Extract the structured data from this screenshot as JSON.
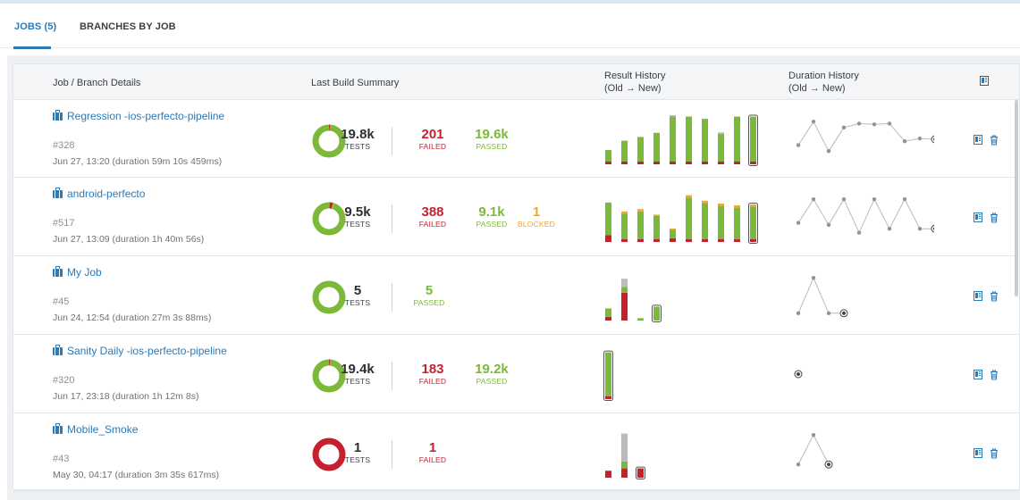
{
  "tabs": [
    {
      "label": "JOBS (5)",
      "active": true
    },
    {
      "label": "BRANCHES BY JOB",
      "active": false
    }
  ],
  "columns": {
    "job": "Job / Branch Details",
    "summary": "Last Build Summary",
    "result_history": "Result History",
    "result_history_sub": "(Old → New)",
    "duration_history": "Duration History",
    "duration_history_sub": "(Old → New)"
  },
  "colors": {
    "accent": "#2a7ab8",
    "passed": "#7cb83a",
    "failed": "#c8202f",
    "blocked": "#f5a623",
    "skipped": "#bbbbbb"
  },
  "jobs": [
    {
      "name": "Regression -ios-perfecto-pipeline",
      "build": "#328",
      "date": "Jun 27, 13:20 (duration 59m 10s 459ms)",
      "tests": "19.8k",
      "tests_label": "TESTS",
      "failed": "201",
      "failed_label": "FAILED",
      "passed": "19.6k",
      "passed_label": "PASSED",
      "blocked": "",
      "blocked_label": "",
      "donut": {
        "passed": 0.99,
        "failed": 0.01,
        "blocked": 0
      },
      "result_history": [
        {
          "passed": 0.25,
          "failed": 0.02,
          "other": 0
        },
        {
          "passed": 0.45,
          "failed": 0.02,
          "other": 0
        },
        {
          "passed": 0.53,
          "failed": 0.02,
          "other": 0
        },
        {
          "passed": 0.62,
          "failed": 0.02,
          "other": 0
        },
        {
          "passed": 0.97,
          "failed": 0.02,
          "other": 0.03
        },
        {
          "passed": 0.97,
          "failed": 0.02,
          "other": 0
        },
        {
          "passed": 0.92,
          "failed": 0.02,
          "other": 0
        },
        {
          "passed": 0.6,
          "failed": 0.02,
          "other": 0.03
        },
        {
          "passed": 0.97,
          "failed": 0.02,
          "other": 0
        },
        {
          "passed": 0.97,
          "failed": 0.02,
          "other": 0,
          "latest": true
        }
      ],
      "duration_history": [
        0.35,
        0.95,
        0.2,
        0.8,
        0.9,
        0.88,
        0.9,
        0.45,
        0.52,
        0.5
      ]
    },
    {
      "name": "android-perfecto",
      "build": "#517",
      "date": "Jun 27, 13:09 (duration 1h 40m 56s)",
      "tests": "9.5k",
      "tests_label": "TESTS",
      "failed": "388",
      "failed_label": "FAILED",
      "passed": "9.1k",
      "passed_label": "PASSED",
      "blocked": "1",
      "blocked_label": "BLOCKED",
      "donut": {
        "passed": 0.959,
        "failed": 0.041,
        "blocked": 0.001
      },
      "result_history": [
        {
          "passed": 0.7,
          "failed": 0.15,
          "other": 0
        },
        {
          "passed": 0.55,
          "failed": 0.04,
          "other": 0.05
        },
        {
          "passed": 0.6,
          "failed": 0.04,
          "other": 0.05
        },
        {
          "passed": 0.5,
          "failed": 0.04,
          "other": 0.03
        },
        {
          "passed": 0.18,
          "failed": 0.08,
          "other": 0.03
        },
        {
          "passed": 0.9,
          "failed": 0.04,
          "other": 0.05
        },
        {
          "passed": 0.78,
          "failed": 0.04,
          "other": 0.05
        },
        {
          "passed": 0.72,
          "failed": 0.04,
          "other": 0.05
        },
        {
          "passed": 0.68,
          "failed": 0.04,
          "other": 0.05
        },
        {
          "passed": 0.7,
          "failed": 0.04,
          "other": 0.05,
          "latest": true
        }
      ],
      "duration_history": [
        0.35,
        0.95,
        0.3,
        0.95,
        0.1,
        0.95,
        0.2,
        0.95,
        0.2,
        0.2
      ]
    },
    {
      "name": "My Job",
      "build": "#45",
      "date": "Jun 24, 12:54 (duration 27m 3s 88ms)",
      "tests": "5",
      "tests_label": "TESTS",
      "failed": "",
      "failed_label": "",
      "passed": "5",
      "passed_label": "PASSED",
      "blocked": "",
      "blocked_label": "",
      "donut": {
        "passed": 1,
        "failed": 0,
        "blocked": 0
      },
      "result_history": [
        {
          "passed": 0.18,
          "failed": 0.08,
          "other": 0
        },
        {
          "passed": 0.12,
          "failed": 0.6,
          "other": 0.18
        },
        {
          "passed": 0.05,
          "failed": 0,
          "other": 0
        },
        {
          "passed": 0.3,
          "failed": 0,
          "other": 0,
          "latest": true
        }
      ],
      "duration_history": [
        0.05,
        0.95,
        0.05,
        0.05
      ]
    },
    {
      "name": "Sanity Daily -ios-perfecto-pipeline",
      "build": "#320",
      "date": "Jun 17, 23:18 (duration 1h 12m 8s)",
      "tests": "19.4k",
      "tests_label": "TESTS",
      "failed": "183",
      "failed_label": "FAILED",
      "passed": "19.2k",
      "passed_label": "PASSED",
      "blocked": "",
      "blocked_label": "",
      "donut": {
        "passed": 0.99,
        "failed": 0.01,
        "blocked": 0
      },
      "result_history": [
        {
          "passed": 0.95,
          "failed": 0.03,
          "other": 0,
          "latest": true
        }
      ],
      "duration_history": [
        0.5
      ]
    },
    {
      "name": "Mobile_Smoke",
      "build": "#43",
      "date": "May 30, 04:17 (duration 3m 35s 617ms)",
      "tests": "1",
      "tests_label": "TESTS",
      "failed": "1",
      "failed_label": "FAILED",
      "passed": "",
      "passed_label": "",
      "blocked": "",
      "blocked_label": "",
      "donut": {
        "passed": 0,
        "failed": 1,
        "blocked": 0
      },
      "result_history": [
        {
          "passed": 0,
          "failed": 0.15,
          "other": 0
        },
        {
          "passed": 0.15,
          "failed": 0.2,
          "other": 0.6
        },
        {
          "passed": 0,
          "failed": 0.2,
          "other": 0,
          "latest": true
        }
      ],
      "duration_history": [
        0.2,
        0.95,
        0.2
      ]
    }
  ]
}
